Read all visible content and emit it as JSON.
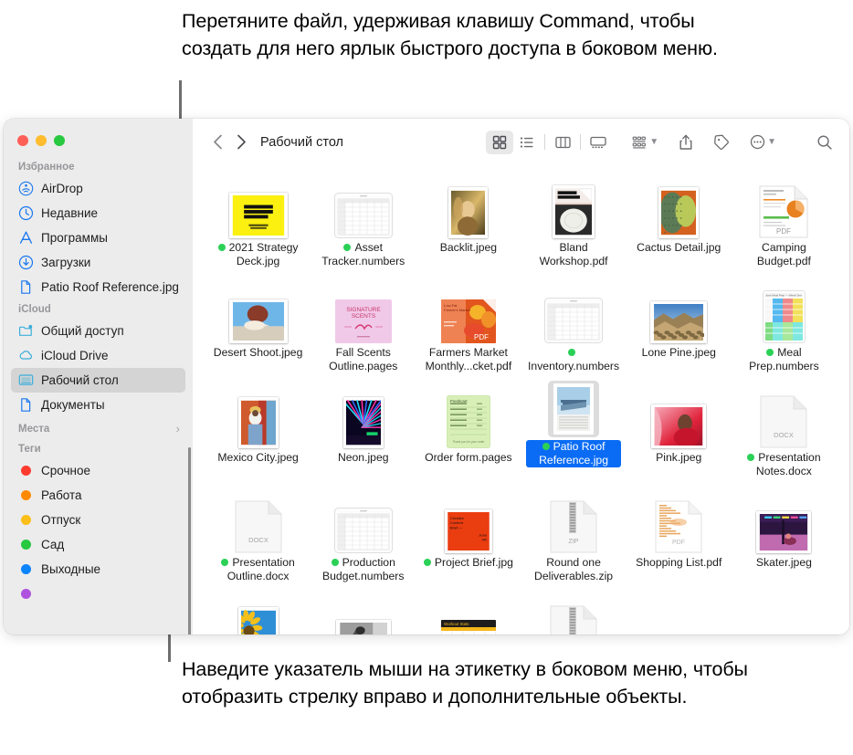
{
  "callouts": {
    "top": "Перетяните файл, удерживая клавишу Command, чтобы создать для него ярлык быстрого доступа в боковом меню.",
    "bottom": "Наведите указатель мыши на этикетку в боковом меню, чтобы отобразить стрелку вправо и дополнительные объекты."
  },
  "window": {
    "traffic_lights": [
      "close",
      "minimize",
      "zoom"
    ]
  },
  "sidebar": {
    "sections": [
      {
        "header": "Избранное",
        "has_chevron": false,
        "items": [
          {
            "label": "AirDrop",
            "icon": "airdrop-icon",
            "selected": false
          },
          {
            "label": "Недавние",
            "icon": "clock-icon",
            "selected": false
          },
          {
            "label": "Программы",
            "icon": "apps-icon",
            "selected": false
          },
          {
            "label": "Загрузки",
            "icon": "download-icon",
            "selected": false
          },
          {
            "label": "Patio Roof Reference.jpg",
            "icon": "document-icon",
            "selected": false
          }
        ]
      },
      {
        "header": "iCloud",
        "has_chevron": false,
        "items": [
          {
            "label": "Общий доступ",
            "icon": "shared-folder-icon",
            "selected": false
          },
          {
            "label": "iCloud Drive",
            "icon": "cloud-icon",
            "selected": false
          },
          {
            "label": "Рабочий стол",
            "icon": "desktop-icon",
            "selected": true
          },
          {
            "label": "Документы",
            "icon": "document-icon",
            "selected": false
          }
        ]
      },
      {
        "header": "Места",
        "has_chevron": true,
        "items": []
      },
      {
        "header": "Теги",
        "has_chevron": false,
        "items": [
          {
            "label": "Срочное",
            "icon": "tag-dot-icon",
            "color": "#ff3b30",
            "selected": false
          },
          {
            "label": "Работа",
            "icon": "tag-dot-icon",
            "color": "#ff8a00",
            "selected": false
          },
          {
            "label": "Отпуск",
            "icon": "tag-dot-icon",
            "color": "#fcbe18",
            "selected": false
          },
          {
            "label": "Сад",
            "icon": "tag-dot-icon",
            "color": "#28c840",
            "selected": false
          },
          {
            "label": "Выходные",
            "icon": "tag-dot-icon",
            "color": "#0a84ff",
            "selected": false
          },
          {
            "label": "",
            "icon": "tag-dot-icon",
            "color": "#af52de",
            "selected": false
          }
        ]
      }
    ]
  },
  "toolbar": {
    "back_icon": "chevron-left-icon",
    "forward_icon": "chevron-right-icon",
    "breadcrumb": "Рабочий стол",
    "views": [
      {
        "name": "icon-view",
        "icon": "grid-icon",
        "active": true
      },
      {
        "name": "list-view",
        "icon": "list-icon",
        "active": false
      },
      {
        "name": "column-view",
        "icon": "columns-icon",
        "active": false
      },
      {
        "name": "gallery-view",
        "icon": "gallery-icon",
        "active": false
      }
    ],
    "group_icon": "group-by-icon",
    "share_icon": "share-icon",
    "tag_icon": "tag-icon",
    "more_icon": "more-ellipsis-icon",
    "search_icon": "search-icon"
  },
  "files": [
    {
      "name": "2021 Strategy Deck.jpg",
      "tag": true,
      "kind": "image",
      "thumb": "spring-strategy"
    },
    {
      "name": "Asset Tracker.numbers",
      "tag": true,
      "kind": "numbers",
      "thumb": "spreadsheet"
    },
    {
      "name": "Backlit.jpeg",
      "tag": false,
      "kind": "image",
      "thumb": "backlit"
    },
    {
      "name": "Bland Workshop.pdf",
      "tag": false,
      "kind": "pdf",
      "thumb": "bland-workshop"
    },
    {
      "name": "Cactus Detail.jpg",
      "tag": false,
      "kind": "image",
      "thumb": "cactus"
    },
    {
      "name": "Camping Budget.pdf",
      "tag": false,
      "kind": "pdf",
      "thumb": "pdf-chart"
    },
    {
      "name": "Desert Shoot.jpeg",
      "tag": false,
      "kind": "image",
      "thumb": "desert"
    },
    {
      "name": "Fall Scents Outline.pages",
      "tag": false,
      "kind": "pages",
      "thumb": "signature-scents"
    },
    {
      "name": "Farmers Market Monthly...cket.pdf",
      "tag": false,
      "kind": "pdf",
      "thumb": "farmers-market"
    },
    {
      "name": "Inventory.numbers",
      "tag": true,
      "kind": "numbers",
      "thumb": "spreadsheet"
    },
    {
      "name": "Lone Pine.jpeg",
      "tag": false,
      "kind": "image",
      "thumb": "lone-pine"
    },
    {
      "name": "Meal Prep.numbers",
      "tag": true,
      "kind": "numbers",
      "thumb": "meal-prep"
    },
    {
      "name": "Mexico City.jpeg",
      "tag": false,
      "kind": "image",
      "thumb": "mexico-city"
    },
    {
      "name": "Neon.jpeg",
      "tag": false,
      "kind": "image",
      "thumb": "neon"
    },
    {
      "name": "Order form.pages",
      "tag": false,
      "kind": "pages",
      "thumb": "order-form"
    },
    {
      "name": "Patio Roof Reference.jpg",
      "tag": true,
      "kind": "image",
      "thumb": "patio-roof",
      "selected": true
    },
    {
      "name": "Pink.jpeg",
      "tag": false,
      "kind": "image",
      "thumb": "pink"
    },
    {
      "name": "Presentation Notes.docx",
      "tag": true,
      "kind": "docx",
      "thumb": "docx"
    },
    {
      "name": "Presentation Outline.docx",
      "tag": true,
      "kind": "docx",
      "thumb": "docx"
    },
    {
      "name": "Production Budget.numbers",
      "tag": true,
      "kind": "numbers",
      "thumb": "spreadsheet"
    },
    {
      "name": "Project Brief.jpg",
      "tag": true,
      "kind": "image",
      "thumb": "project-brief"
    },
    {
      "name": "Round one Deliverables.zip",
      "tag": false,
      "kind": "zip",
      "thumb": "zip"
    },
    {
      "name": "Shopping List.pdf",
      "tag": false,
      "kind": "pdf",
      "thumb": "shopping-list"
    },
    {
      "name": "Skater.jpeg",
      "tag": false,
      "kind": "image",
      "thumb": "skater"
    },
    {
      "name": "",
      "tag": false,
      "kind": "image",
      "thumb": "sunflower",
      "partial": true
    },
    {
      "name": "",
      "tag": false,
      "kind": "image",
      "thumb": "bw-photo",
      "partial": true
    },
    {
      "name": "",
      "tag": false,
      "kind": "image",
      "thumb": "workout",
      "partial": true
    },
    {
      "name": "",
      "tag": false,
      "kind": "zip",
      "thumb": "zip",
      "partial": true
    }
  ],
  "colors": {
    "accent": "#0a6cf5",
    "sidebar_icon": "#1878f0",
    "tag_green": "#2ad156",
    "sidebar_bg": "#ececec"
  }
}
